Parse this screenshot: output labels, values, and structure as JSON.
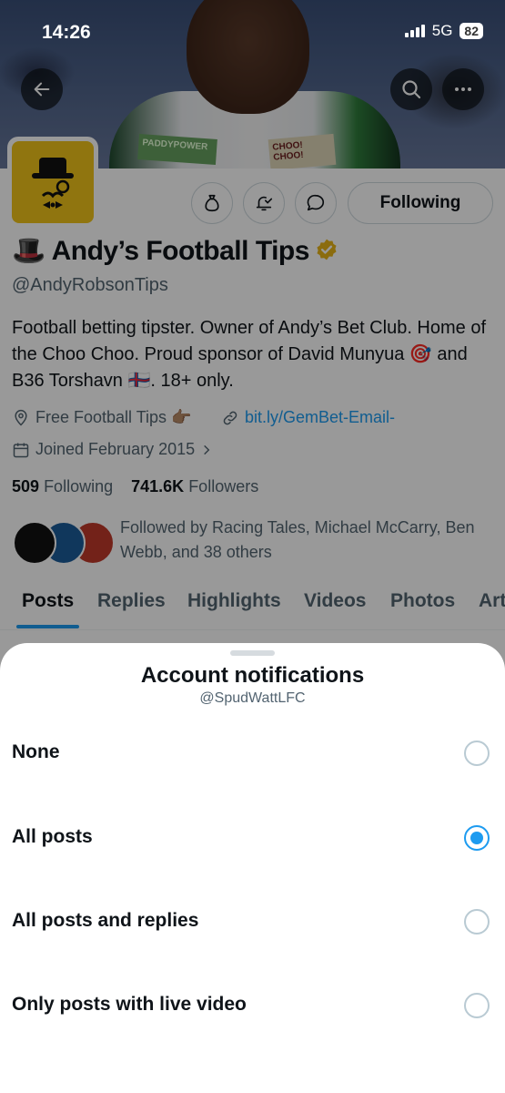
{
  "status_bar": {
    "time": "14:26",
    "network": "5G",
    "battery": "82"
  },
  "banner": {
    "patch_left": "PADDYPOWER",
    "patch_right": "CHOO! CHOO!"
  },
  "header_buttons": {
    "back_icon": "arrow-left-icon",
    "search_icon": "search-icon",
    "more_icon": "more-icon"
  },
  "profile": {
    "name_emoji": "🎩",
    "name": "Andy’s Football Tips",
    "handle": "@AndyRobsonTips",
    "bio": "Football betting tipster. Owner of Andy’s Bet Club. Home of the Choo Choo. Proud sponsor of David Munyua 🎯 and B36 Torshavn 🇫🇴. 18+ only.",
    "location": "Free Football Tips 👉🏽",
    "link": "bit.ly/GemBet-Email-",
    "joined": "Joined February 2015",
    "following_count": "509",
    "following_label": "Following",
    "followers_count": "741.6K",
    "followers_label": "Followers",
    "followed_by": "Followed by Racing Tales, Michael McCarry, Ben Webb, and 38 others",
    "following_button": "Following"
  },
  "tabs": [
    "Posts",
    "Replies",
    "Highlights",
    "Videos",
    "Photos",
    "Art"
  ],
  "sheet": {
    "title": "Account notifications",
    "subtitle": "@SpudWattLFC",
    "options": [
      {
        "label": "None",
        "selected": false
      },
      {
        "label": "All posts",
        "selected": true
      },
      {
        "label": "All posts and replies",
        "selected": false
      },
      {
        "label": "Only posts with live video",
        "selected": false
      }
    ]
  },
  "colors": {
    "accent": "#1d9bf0",
    "avatar_bg": "#f0c419",
    "verified": "#e8b418"
  }
}
